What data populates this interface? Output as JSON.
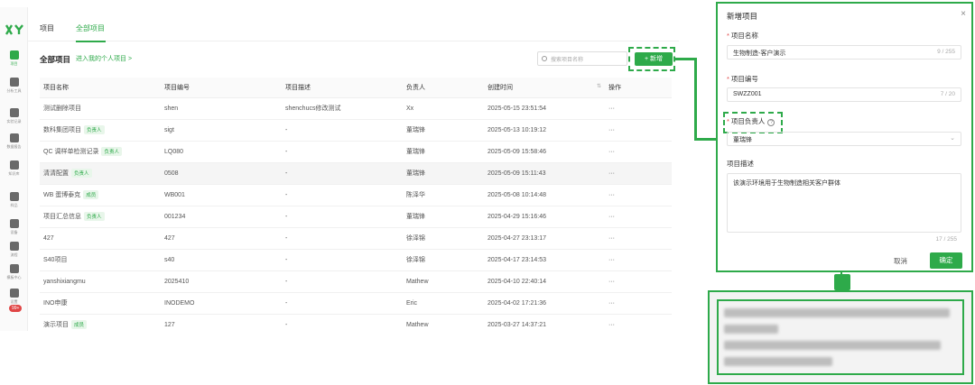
{
  "app": {
    "sidebar": [
      {
        "label": "项目",
        "active": true
      },
      {
        "label": "分析工具",
        "active": false
      },
      {
        "label": "实验记录",
        "active": false
      },
      {
        "label": "数据报告",
        "active": false
      },
      {
        "label": "知识库",
        "active": false
      },
      {
        "label": "样品",
        "active": false
      },
      {
        "label": "设备",
        "active": false
      },
      {
        "label": "流程",
        "active": false
      },
      {
        "label": "模板中心",
        "active": false
      },
      {
        "label": "设置",
        "active": false
      }
    ],
    "sidebar_badge": "99+",
    "tabs": [
      "项目",
      "全部项目"
    ],
    "subhead": {
      "title": "全部项目",
      "link": "进入我的个人项目 >"
    },
    "search_placeholder": "搜索项目名称",
    "new_button": "+ 新增",
    "table": {
      "headers": [
        "项目名称",
        "项目编号",
        "项目描述",
        "负责人",
        "创建时间",
        "操作"
      ],
      "rows": [
        {
          "name": "测试删除项目",
          "tag": "",
          "code": "shen",
          "desc": "shenchucs修改测试",
          "owner": "Xx",
          "time": "2025-05-15 23:51:54"
        },
        {
          "name": "数科集团项目",
          "tag": "负责人",
          "code": "sigt",
          "desc": "-",
          "owner": "董瑞锋",
          "time": "2025-05-13 10:19:12"
        },
        {
          "name": "QC 调样单检测记录",
          "tag": "负责人",
          "code": "LQ080",
          "desc": "-",
          "owner": "董瑞锋",
          "time": "2025-05-09 15:58:46"
        },
        {
          "name": "清清配置",
          "tag": "负责人",
          "code": "0508",
          "desc": "-",
          "owner": "董瑞锋",
          "time": "2025-05-09 15:11:43"
        },
        {
          "name": "WB 蛋博泰克",
          "tag": "成员",
          "code": "WB001",
          "desc": "-",
          "owner": "陈泽华",
          "time": "2025-05-08 10:14:48"
        },
        {
          "name": "项目汇总信息",
          "tag": "负责人",
          "code": "001234",
          "desc": "-",
          "owner": "董瑞锋",
          "time": "2025-04-29 15:16:46"
        },
        {
          "name": "427",
          "tag": "",
          "code": "427",
          "desc": "-",
          "owner": "徐泽锦",
          "time": "2025-04-27 23:13:17"
        },
        {
          "name": "S40项目",
          "tag": "",
          "code": "s40",
          "desc": "-",
          "owner": "徐泽锦",
          "time": "2025-04-17 23:14:53"
        },
        {
          "name": "yanshixiangmu",
          "tag": "",
          "code": "2025410",
          "desc": "-",
          "owner": "Mathew",
          "time": "2025-04-10 22:40:14"
        },
        {
          "name": "INO申康",
          "tag": "",
          "code": "INODEMO",
          "desc": "-",
          "owner": "Eric",
          "time": "2025-04-02 17:21:36"
        },
        {
          "name": "演示项目",
          "tag": "成员",
          "code": "127",
          "desc": "-",
          "owner": "Mathew",
          "time": "2025-03-27 14:37:21"
        }
      ],
      "row_action": "···"
    }
  },
  "modal": {
    "title": "新增项目",
    "close": "×",
    "name_label": "项目名称",
    "name_value": "生物制造-客户演示",
    "name_count": "9 / 255",
    "code_label": "项目编号",
    "code_value": "SWZZ001",
    "code_count": "7 / 20",
    "owner_label": "项目负责人",
    "owner_value": "董瑞锋",
    "desc_label": "项目描述",
    "desc_value": "该演示环境用于生物制造相关客户群体",
    "desc_count": "17 / 255",
    "cancel": "取消",
    "ok": "确定"
  },
  "colors": {
    "accent": "#2eaa4a"
  }
}
